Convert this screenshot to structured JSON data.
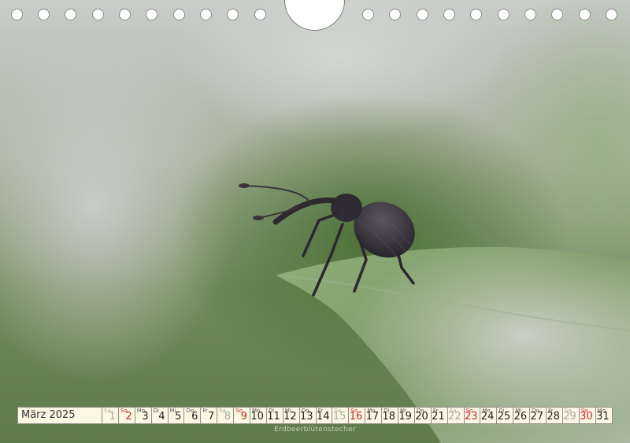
{
  "calendar": {
    "month_label": "März 2025",
    "days": [
      {
        "n": "Sa",
        "d": "1",
        "type": "sat"
      },
      {
        "n": "So",
        "d": "2",
        "type": "sun"
      },
      {
        "n": "Mo",
        "d": "3",
        "type": "wd"
      },
      {
        "n": "Di",
        "d": "4",
        "type": "wd"
      },
      {
        "n": "Mi",
        "d": "5",
        "type": "wd"
      },
      {
        "n": "Do",
        "d": "6",
        "type": "wd"
      },
      {
        "n": "Fr",
        "d": "7",
        "type": "wd"
      },
      {
        "n": "Sa",
        "d": "8",
        "type": "sat"
      },
      {
        "n": "So",
        "d": "9",
        "type": "sun"
      },
      {
        "n": "Mo",
        "d": "10",
        "type": "wd"
      },
      {
        "n": "Di",
        "d": "11",
        "type": "wd"
      },
      {
        "n": "Mi",
        "d": "12",
        "type": "wd"
      },
      {
        "n": "Do",
        "d": "13",
        "type": "wd"
      },
      {
        "n": "Fr",
        "d": "14",
        "type": "wd"
      },
      {
        "n": "Sa",
        "d": "15",
        "type": "sat"
      },
      {
        "n": "So",
        "d": "16",
        "type": "sun"
      },
      {
        "n": "Mo",
        "d": "17",
        "type": "wd"
      },
      {
        "n": "Di",
        "d": "18",
        "type": "wd"
      },
      {
        "n": "Mi",
        "d": "19",
        "type": "wd"
      },
      {
        "n": "Do",
        "d": "20",
        "type": "wd"
      },
      {
        "n": "Fr",
        "d": "21",
        "type": "wd"
      },
      {
        "n": "Sa",
        "d": "22",
        "type": "sat"
      },
      {
        "n": "So",
        "d": "23",
        "type": "sun"
      },
      {
        "n": "Mo",
        "d": "24",
        "type": "wd"
      },
      {
        "n": "Di",
        "d": "25",
        "type": "wd"
      },
      {
        "n": "Mi",
        "d": "26",
        "type": "wd"
      },
      {
        "n": "Do",
        "d": "27",
        "type": "wd"
      },
      {
        "n": "Fr",
        "d": "28",
        "type": "wd"
      },
      {
        "n": "Sa",
        "d": "29",
        "type": "sat"
      },
      {
        "n": "So",
        "d": "30",
        "type": "sun"
      },
      {
        "n": "Mo",
        "d": "31",
        "type": "wd"
      }
    ]
  },
  "caption": "Erdbeerblütenstecher",
  "photo": {
    "subject_icon": "weevil-on-leaf"
  },
  "colors": {
    "sunday": "#d4252d",
    "saturday": "#a9a9a4",
    "calendar_bg": "#faf7e2"
  }
}
